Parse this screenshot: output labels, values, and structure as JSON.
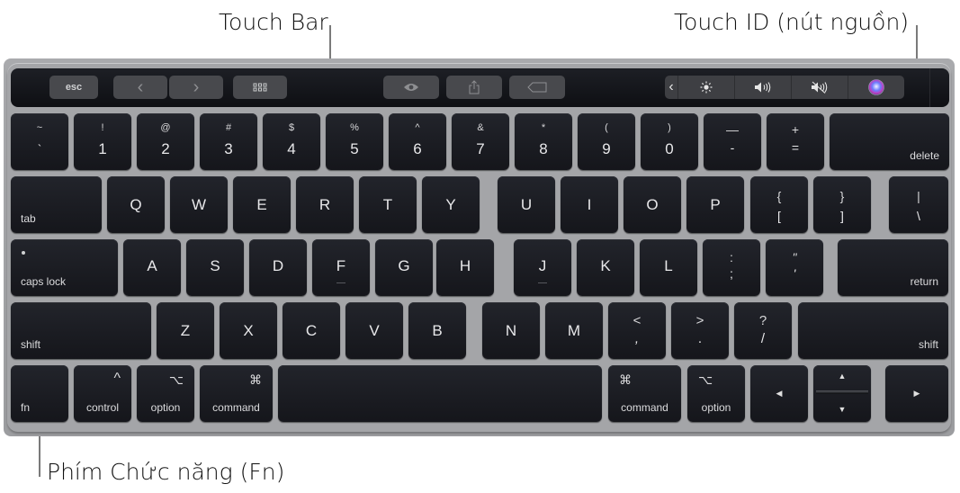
{
  "callouts": {
    "touch_bar": "Touch Bar",
    "touch_id": "Touch ID (nút nguồn)",
    "fn_key": "Phím Chức năng (Fn)"
  },
  "touch_bar": {
    "esc": "esc",
    "back": "‹",
    "forward": "›",
    "launchpad": "launchpad-grid-icon",
    "quick_look": "eye-icon",
    "share": "share-icon",
    "tags": "tag-icon",
    "control_strip": {
      "collapse": "‹",
      "items": [
        "brightness-icon",
        "volume-icon",
        "mute-icon",
        "siri-icon"
      ]
    },
    "touch_id": "touch-id-sensor"
  },
  "rows": {
    "number": [
      {
        "top": "~",
        "bot": "`"
      },
      {
        "top": "!",
        "bot": "1"
      },
      {
        "top": "@",
        "bot": "2"
      },
      {
        "top": "#",
        "bot": "3"
      },
      {
        "top": "$",
        "bot": "4"
      },
      {
        "top": "%",
        "bot": "5"
      },
      {
        "top": "^",
        "bot": "6"
      },
      {
        "top": "&",
        "bot": "7"
      },
      {
        "top": "*",
        "bot": "8"
      },
      {
        "top": "(",
        "bot": "9"
      },
      {
        "top": ")",
        "bot": "0"
      },
      {
        "top": "—",
        "bot": "-"
      },
      {
        "top": "+",
        "bot": "="
      }
    ],
    "delete": "delete",
    "tab": "tab",
    "qwerty": [
      "Q",
      "W",
      "E",
      "R",
      "T",
      "Y",
      "U",
      "I",
      "O",
      "P"
    ],
    "brackets": [
      {
        "top": "{",
        "bot": "["
      },
      {
        "top": "}",
        "bot": "]"
      },
      {
        "top": "|",
        "bot": "\\"
      }
    ],
    "caps_lock": "caps lock",
    "home": [
      "A",
      "S",
      "D",
      "F",
      "G",
      "H",
      "J",
      "K",
      "L"
    ],
    "home_punct": [
      {
        "top": ":",
        "bot": ";"
      },
      {
        "top": "\"",
        "bot": "'"
      }
    ],
    "return": "return",
    "shift": "shift",
    "bottom_letters": [
      "Z",
      "X",
      "C",
      "V",
      "B",
      "N",
      "M"
    ],
    "bottom_punct": [
      {
        "top": "<",
        "bot": ","
      },
      {
        "top": ">",
        "bot": "."
      },
      {
        "top": "?",
        "bot": "/"
      }
    ],
    "shift_right": "shift"
  },
  "modifiers": {
    "fn": "fn",
    "control": {
      "symbol": "^",
      "label": "control"
    },
    "option": {
      "symbol": "⌥",
      "label": "option"
    },
    "command": {
      "symbol": "⌘",
      "label": "command"
    },
    "command_right": {
      "symbol": "⌘",
      "label": "command"
    },
    "option_right": {
      "symbol": "⌥",
      "label": "option"
    },
    "arrows": {
      "left": "◀",
      "up": "▲",
      "down": "▼",
      "right": "▶"
    }
  }
}
